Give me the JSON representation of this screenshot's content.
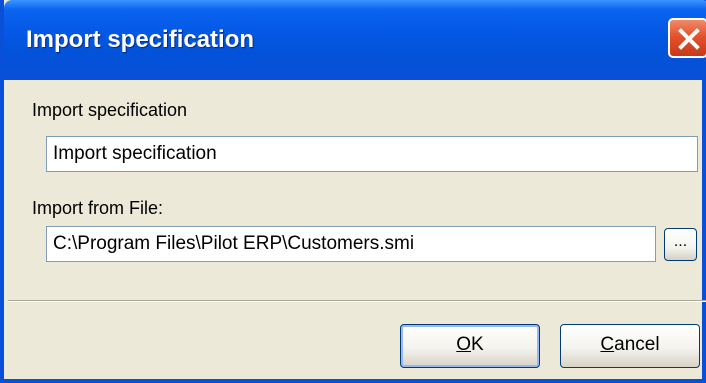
{
  "window": {
    "title": "Import specification",
    "close_icon": "close-icon"
  },
  "form": {
    "spec_label": "Import specification",
    "spec_value": "Import specification",
    "file_label": "Import from File:",
    "file_value": "C:\\Program Files\\Pilot ERP\\Customers.smi",
    "browse_label": "..."
  },
  "buttons": {
    "ok_label": "OK",
    "cancel_label": "Cancel"
  },
  "colors": {
    "titlebar": "#0a4fd8",
    "dialog_bg": "#ece9d8",
    "close_red": "#e2532c"
  }
}
